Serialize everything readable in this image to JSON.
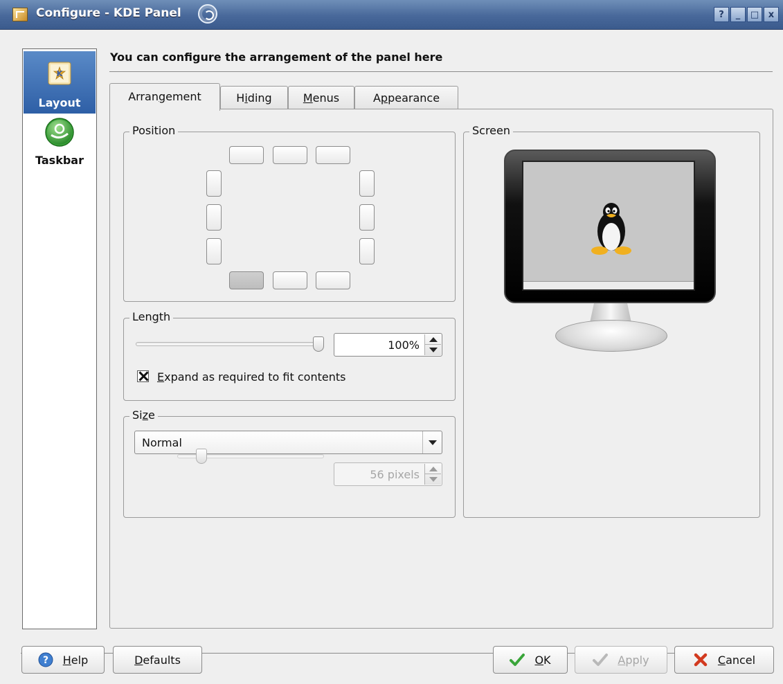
{
  "window": {
    "title": "Configure - KDE Panel",
    "buttons": {
      "help": "?",
      "minimize": "_",
      "maximize": "□",
      "close": "x"
    }
  },
  "sidebar": {
    "items": [
      {
        "label": "Layout",
        "icon": "kde-layout-icon",
        "selected": true
      },
      {
        "label": "Taskbar",
        "icon": "opensuse-icon",
        "selected": false
      }
    ]
  },
  "main": {
    "header": "You can configure the arrangement of the panel here",
    "tabs": [
      {
        "pre": "Arran",
        "mnemonic": "g",
        "post": "ement",
        "active": true
      },
      {
        "pre": "H",
        "mnemonic": "i",
        "post": "ding",
        "active": false
      },
      {
        "pre": "",
        "mnemonic": "M",
        "post": "enus",
        "active": false
      },
      {
        "pre": "A",
        "mnemonic": "p",
        "post": "pearance",
        "active": false
      }
    ]
  },
  "position": {
    "title": "Position",
    "selected": "bottom-left"
  },
  "length": {
    "title_pre": "Len",
    "title_mnemonic": "g",
    "title_post": "th",
    "value": "100%",
    "slider_fraction": 1.0,
    "expand_checked": true,
    "expand_mnemonic": "E",
    "expand_rest": "xpand as required to fit contents"
  },
  "size": {
    "title_pre": "Si",
    "title_mnemonic": "z",
    "title_post": "e",
    "selected": "Normal",
    "custom_value": "56 pixels",
    "slider_fraction": 0.22
  },
  "screen": {
    "title": "Screen"
  },
  "buttons": {
    "help": {
      "mnemonic": "H",
      "rest": "elp"
    },
    "defaults": {
      "mnemonic": "D",
      "rest": "efaults"
    },
    "ok": {
      "mnemonic": "O",
      "rest": "K"
    },
    "apply": {
      "mnemonic": "A",
      "rest": "pply"
    },
    "cancel": {
      "mnemonic": "C",
      "rest": "ancel"
    }
  },
  "colors": {
    "titlebar": "#48689a",
    "selection": "#2e5fa6",
    "ok_check": "#3aa53a",
    "cancel_x": "#d23a1f"
  }
}
